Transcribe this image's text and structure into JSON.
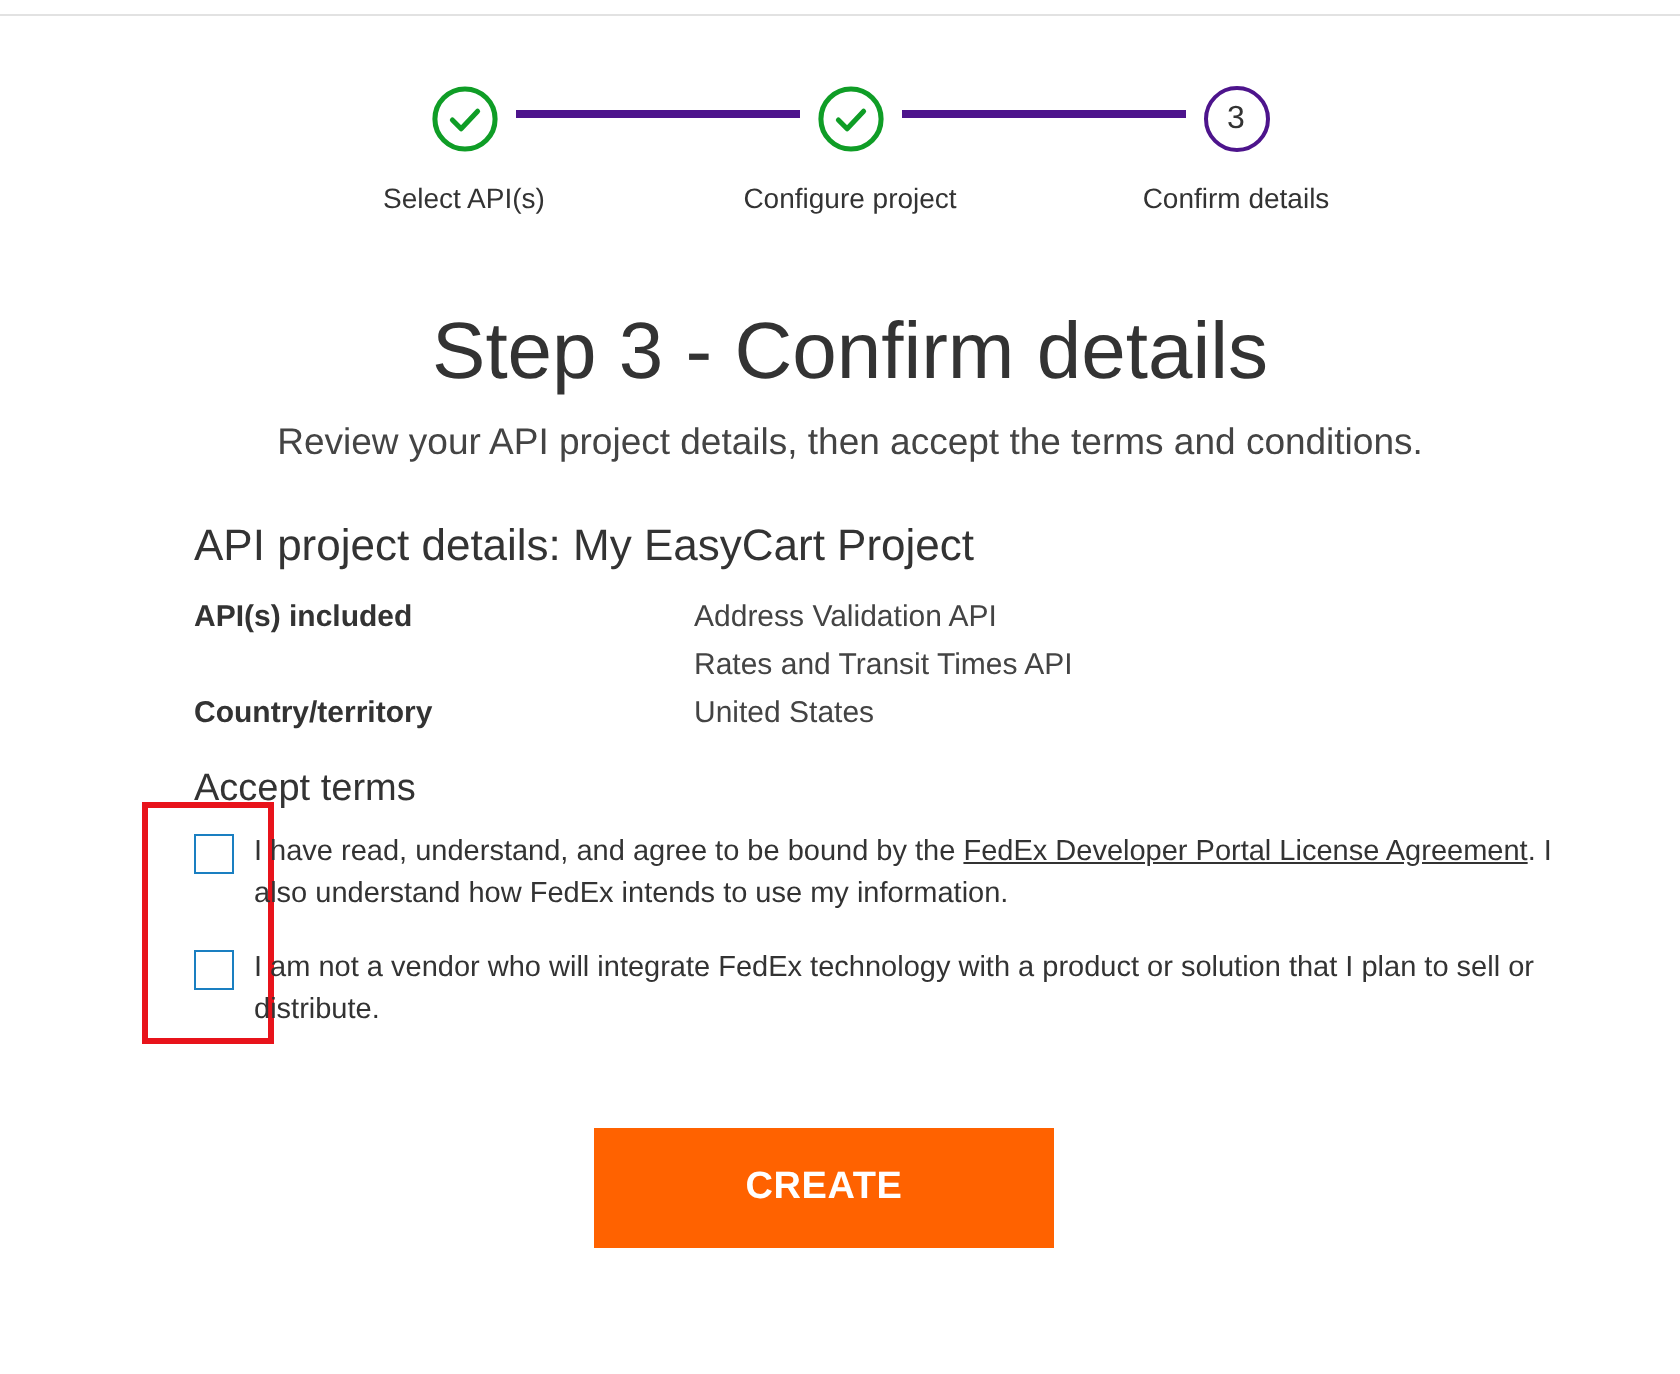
{
  "steps": [
    {
      "label": "Select API(s)",
      "completed": true
    },
    {
      "label": "Configure project",
      "completed": true
    },
    {
      "label": "Confirm details",
      "completed": false,
      "number": "3"
    }
  ],
  "title": "Step 3 - Confirm details",
  "subtitle": "Review your API project details, then accept the terms and conditions.",
  "details": {
    "heading": "API project details: My EasyCart Project",
    "rows": [
      {
        "label": "API(s) included",
        "values": [
          "Address Validation API",
          "Rates and Transit Times API"
        ]
      },
      {
        "label": "Country/territory",
        "values": [
          "United States"
        ]
      }
    ]
  },
  "terms": {
    "heading": "Accept terms",
    "items": [
      {
        "checked": false,
        "text": "I have read, understand, and agree to be bound by the",
        "link": "FedEx Developer Portal License Agreement",
        "text_after": ". I also understand how FedEx intends to use my information."
      },
      {
        "checked": false,
        "text": "I am not a vendor who will integrate FedEx technology with a product or solution that I plan to sell or distribute."
      }
    ]
  },
  "annotation": {
    "kind": "highlight-box"
  },
  "button": {
    "label": "CREATE"
  }
}
